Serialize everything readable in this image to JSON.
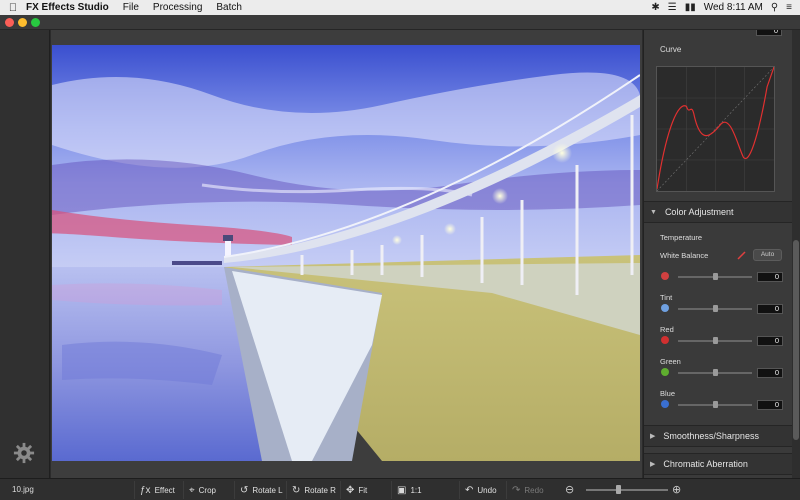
{
  "menubar": {
    "app_name": "FX Effects Studio",
    "menus": [
      "File",
      "Processing",
      "Batch"
    ],
    "clock": "Wed 8:11 AM"
  },
  "panel": {
    "top_value": "0",
    "curve_label": "Curve",
    "color_adjustment": {
      "title": "Color Adjustment",
      "temperature_label": "Temperature",
      "white_balance_label": "White Balance",
      "auto_label": "Auto",
      "rows": [
        {
          "label": "",
          "value": "0",
          "level": 0.5,
          "icon_color": "#d04040"
        },
        {
          "label": "Tint",
          "value": "0",
          "level": 0.5,
          "icon_color": "#6fa0e0"
        },
        {
          "label": "Red",
          "value": "0",
          "level": 0.5,
          "icon_color": "#d03030"
        },
        {
          "label": "Green",
          "value": "0",
          "level": 0.5,
          "icon_color": "#5fae2f"
        },
        {
          "label": "Blue",
          "value": "0",
          "level": 0.5,
          "icon_color": "#3a6fd0"
        }
      ]
    },
    "smoothness_title": "Smoothness/Sharpness",
    "chromatic_title": "Chromatic Aberration"
  },
  "toolbar": {
    "file_name": "10.jpg",
    "effect_label": "Effect",
    "crop_label": "Crop",
    "rotate_left_label": "Rotate L",
    "rotate_right_label": "Rotate R",
    "fit_label": "Fit",
    "one_to_one_label": "1:1",
    "undo_label": "Undo",
    "redo_label": "Redo",
    "zoom_level": 0.4
  }
}
